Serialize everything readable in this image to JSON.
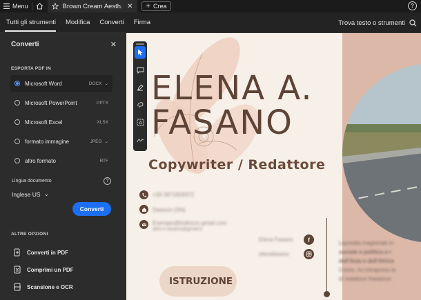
{
  "titlebar": {
    "menu_label": "Menu",
    "tab_title": "Brown Cream Aesth...",
    "create_label": "Crea"
  },
  "navbar": {
    "items": [
      "Tutti gli strumenti",
      "Modifica",
      "Converti",
      "Firma"
    ],
    "search_label": "Trova testo o strumenti"
  },
  "panel": {
    "title": "Converti",
    "export_label": "ESPORTA PDF IN",
    "options": [
      {
        "label": "Microsoft Word",
        "format": "DOCX",
        "has_chevron": true,
        "selected": true
      },
      {
        "label": "Microsoft PowerPoint",
        "format": "PPTX",
        "has_chevron": false,
        "selected": false
      },
      {
        "label": "Microsoft Excel",
        "format": "XLSX",
        "has_chevron": false,
        "selected": false
      },
      {
        "label": "formato immagine",
        "format": "JPEG",
        "has_chevron": true,
        "selected": false
      },
      {
        "label": "altro formato",
        "format": "RTF",
        "has_chevron": false,
        "selected": false
      }
    ],
    "language_label": "Lingua documento",
    "language_value": "Inglese US",
    "convert_button": "Converti",
    "more_label": "ALTRE OPZIONI",
    "more_items": [
      "Converti in PDF",
      "Comprimi un PDF",
      "Scansione e OCR"
    ]
  },
  "document": {
    "name_line1": "ELENA A.",
    "name_line2": "FASANO",
    "subtitle": "Copywriter / Redattore",
    "contact_1": "+39 3971828372",
    "contact_2": "Dawson (SN)",
    "contact_3a": "Esempio@indirizzo.gmail.com",
    "contact_3b": "altro e.fasano@gmail.it",
    "social_1": "Elena Fasano",
    "social_2": "elenafasano",
    "bio_lines": [
      "Laureata magistrale in",
      "sociale e politica e r",
      "dell'Asia e dell'Africa",
      "Comix, ho intrapreso la",
      "di redattore freelance."
    ],
    "section_title": "ISTRUZIONE"
  },
  "colors": {
    "accent_blue": "#1d6ff2",
    "doc_brown": "#5d4436",
    "doc_background": "#f6f0e8",
    "doc_salmon": "#dcb8a9"
  }
}
